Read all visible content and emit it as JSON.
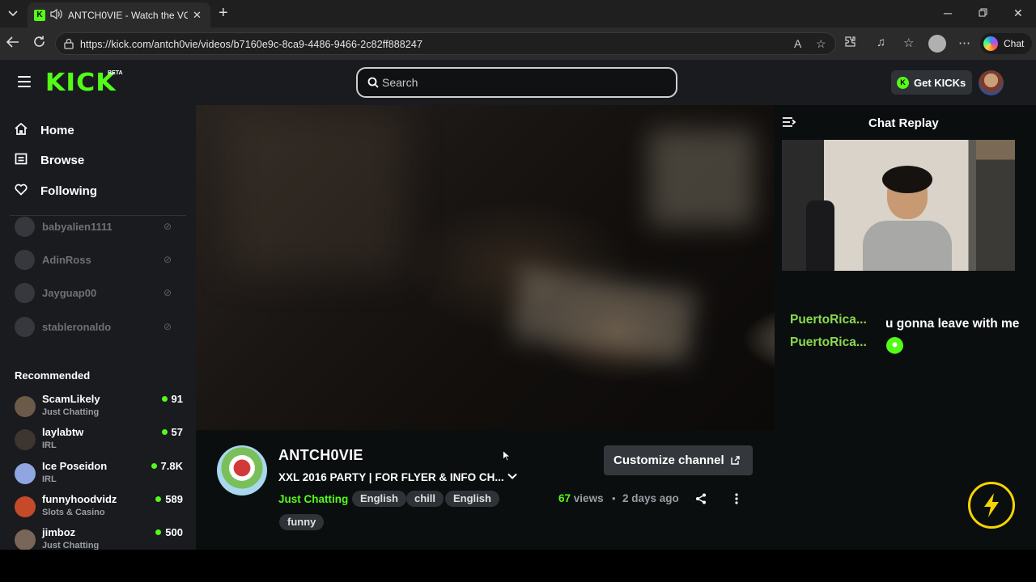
{
  "browser": {
    "tab_title": "ANTCH0VIE - Watch the VOD",
    "url": "https://kick.com/antch0vie/videos/b7160e9c-8ca9-4486-9466-2c82ff888247",
    "copilot_label": "Chat"
  },
  "header": {
    "logo": "KICK",
    "logo_badge": "BETA",
    "search_placeholder": "Search",
    "get_kicks_label": "Get KICKs"
  },
  "sidebar": {
    "nav": [
      {
        "label": "Home",
        "icon": "home-icon"
      },
      {
        "label": "Browse",
        "icon": "browse-icon"
      },
      {
        "label": "Following",
        "icon": "heart-icon"
      }
    ],
    "following": [
      {
        "name": "babyalien1111"
      },
      {
        "name": "AdinRoss"
      },
      {
        "name": "Jayguap00"
      },
      {
        "name": "stableronaldo"
      }
    ],
    "recommended_title": "Recommended",
    "recommended": [
      {
        "name": "ScamLikely",
        "category": "Just Chatting",
        "viewers": "91",
        "avatar_color": "#6b5a4a"
      },
      {
        "name": "laylabtw",
        "category": "IRL",
        "viewers": "57",
        "avatar_color": "#3d3530"
      },
      {
        "name": "Ice Poseidon",
        "category": "IRL",
        "viewers": "7.8K",
        "avatar_color": "#8fa6e0"
      },
      {
        "name": "funnyhoodvidz",
        "category": "Slots & Casino",
        "viewers": "589",
        "avatar_color": "#c44a2a"
      },
      {
        "name": "jimboz",
        "category": "Just Chatting",
        "viewers": "500",
        "avatar_color": "#7a6658"
      }
    ]
  },
  "channel": {
    "name": "ANTCH0VIE",
    "title": "XXL 2016 PARTY | FOR FLYER & INFO CH...",
    "category": "Just Chatting",
    "tags": [
      "English",
      "chill",
      "English",
      "funny"
    ],
    "customize_label": "Customize channel",
    "views_count": "67",
    "views_label": "views",
    "separator": "•",
    "posted": "2 days ago"
  },
  "chat": {
    "title": "Chat Replay",
    "messages": [
      {
        "user": "PuertoRica...",
        "text": "u gonna leave with me"
      },
      {
        "user": "PuertoRica...",
        "text": ""
      }
    ]
  },
  "colors": {
    "kick_green": "#53fc18",
    "bolt_yellow": "#f5d400"
  }
}
